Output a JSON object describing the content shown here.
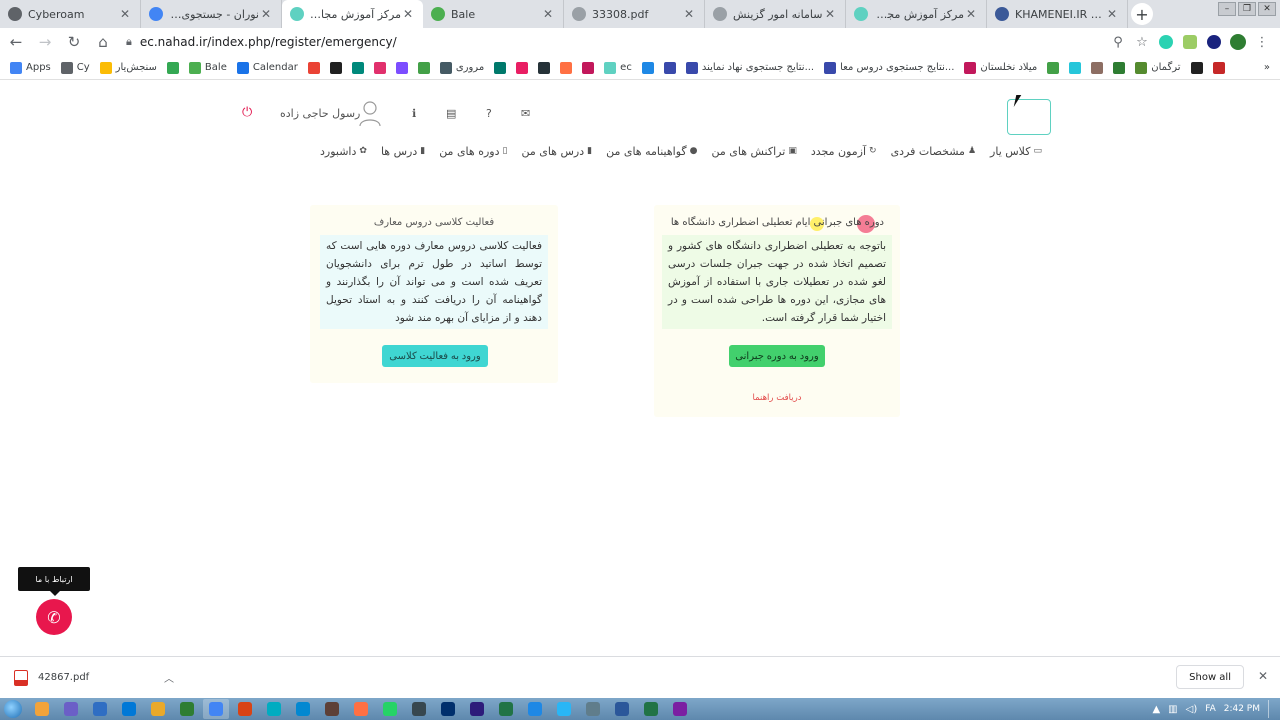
{
  "browser": {
    "tabs": [
      {
        "label": "Cyberoam",
        "favicon_color": "#5f6368",
        "active": false,
        "ltr": true
      },
      {
        "label": "نوران - جستجوی Google",
        "favicon_color": "#4285f4",
        "active": false,
        "ltr": false
      },
      {
        "label": "مرکز آموزش مجازی دانشگا",
        "favicon_color": "#5fd1c1",
        "active": true,
        "ltr": false
      },
      {
        "label": "Bale",
        "favicon_color": "#4caf50",
        "active": false,
        "ltr": true
      },
      {
        "label": "33308.pdf",
        "favicon_color": "#9aa0a6",
        "active": false,
        "ltr": true
      },
      {
        "label": "سامانه امور گزینش",
        "favicon_color": "#9aa0a6",
        "active": false,
        "ltr": false
      },
      {
        "label": "مرکز آموزش مجازی دانشگا",
        "favicon_color": "#5fd1c1",
        "active": false,
        "ltr": false
      },
      {
        "label": "KHAMENEI.IR - پایگاه",
        "favicon_color": "#3b5998",
        "active": false,
        "ltr": true
      }
    ],
    "url": "ec.nahad.ir/index.php/register/emergency/",
    "bookmarks": [
      {
        "label": "Apps",
        "color": "#4285f4"
      },
      {
        "label": "Cy",
        "color": "#5f6368"
      },
      {
        "label": "سنجش‌یار",
        "color": "#fbbc05"
      },
      {
        "label": "",
        "color": "#34a853"
      },
      {
        "label": "Bale",
        "color": "#4caf50"
      },
      {
        "label": "Calendar",
        "color": "#1a73e8"
      },
      {
        "label": "",
        "color": "#ea4335"
      },
      {
        "label": "",
        "color": "#212121"
      },
      {
        "label": "",
        "color": "#00897b"
      },
      {
        "label": "",
        "color": "#e1306c"
      },
      {
        "label": "",
        "color": "#7c4dff"
      },
      {
        "label": "",
        "color": "#43a047"
      },
      {
        "label": "مروری",
        "color": "#455a64"
      },
      {
        "label": "",
        "color": "#00796b"
      },
      {
        "label": "",
        "color": "#e91e63"
      },
      {
        "label": "",
        "color": "#263238"
      },
      {
        "label": "",
        "color": "#ff7043"
      },
      {
        "label": "",
        "color": "#c2185b"
      },
      {
        "label": "ec",
        "color": "#5fd1c1"
      },
      {
        "label": "",
        "color": "#1e88e5"
      },
      {
        "label": "",
        "color": "#3949ab"
      },
      {
        "label": "نتایج جستجوی نهاد نمایند...",
        "color": "#3949ab"
      },
      {
        "label": "نتایج جستجوی دروس معا...",
        "color": "#3949ab"
      },
      {
        "label": "میلاد نخلستان",
        "color": "#c2185b"
      },
      {
        "label": "",
        "color": "#43a047"
      },
      {
        "label": "",
        "color": "#26c6da"
      },
      {
        "label": "",
        "color": "#8d6e63"
      },
      {
        "label": "",
        "color": "#2e7d32"
      },
      {
        "label": "ترگمان",
        "color": "#558b2f"
      },
      {
        "label": "",
        "color": "#212121"
      },
      {
        "label": "",
        "color": "#c62828"
      }
    ]
  },
  "site": {
    "username": "رسول حاجی زاده",
    "nav": [
      {
        "label": "داشبورد",
        "icon": "dashboard-icon",
        "glyph": "✿"
      },
      {
        "label": "درس ها",
        "icon": "book-icon",
        "glyph": "▮"
      },
      {
        "label": "دوره های من",
        "icon": "bookmark-icon",
        "glyph": "▯"
      },
      {
        "label": "درس های من",
        "icon": "book-icon",
        "glyph": "▮"
      },
      {
        "label": "گواهینامه های من",
        "icon": "certificate-icon",
        "glyph": "●"
      },
      {
        "label": "تراکنش های من",
        "icon": "money-icon",
        "glyph": "▣"
      },
      {
        "label": "آزمون مجدد",
        "icon": "refresh-icon",
        "glyph": "↻"
      },
      {
        "label": "مشخصات فردی",
        "icon": "user-icon",
        "glyph": "♟"
      },
      {
        "label": "کلاس یار",
        "icon": "monitor-icon",
        "glyph": "▭"
      }
    ],
    "class_card": {
      "title": "فعالیت کلاسی دروس معارف",
      "body": "فعالیت کلاسی دروس معارف دوره هایی است که توسط اساتید در طول ترم برای دانشجویان تعریف شده است و می تواند آن را بگذارنند و گواهینامه آن را دریافت کنند و به استاد تحویل دهند و از مزایای آن بهره مند شود",
      "button": "ورود به فعالیت کلاسی"
    },
    "compensatory_card": {
      "title": "دوره های جبرانی ایام تعطیلی اضطراری دانشگاه ها",
      "body": "باتوجه به تعطیلی اضطراری دانشگاه های کشور و تصمیم اتخاذ شده در جهت جبران جلسات درسی لغو شده در تعطیلات جاری با استفاده از آموزش های مجازی، این دوره ها طراحی شده است و در اختیار شما قرار گرفته است.",
      "button": "ورود به دوره جبرانی",
      "guide_link": "دریافت راهنما"
    },
    "contact_tooltip": "ارتباط با ما"
  },
  "downloads": {
    "file": "42867.pdf",
    "show_all": "Show all"
  },
  "taskbar": {
    "language": "FA",
    "time": "2:42 PM",
    "app_colors": [
      "#f2a33a",
      "#6b5fc7",
      "#2f6ec3",
      "#0078d7",
      "#e9a92b",
      "#2e7d32",
      "#4285f4",
      "#d84315",
      "#00acc1",
      "#0288d1",
      "#5d4037",
      "#ff7043",
      "#25d366",
      "#37474f",
      "#002f6c",
      "#2d1b7a",
      "#217346",
      "#1e88e5",
      "#29b6f6",
      "#607d8b",
      "#2b579a",
      "#217346",
      "#7b1fa2"
    ]
  }
}
